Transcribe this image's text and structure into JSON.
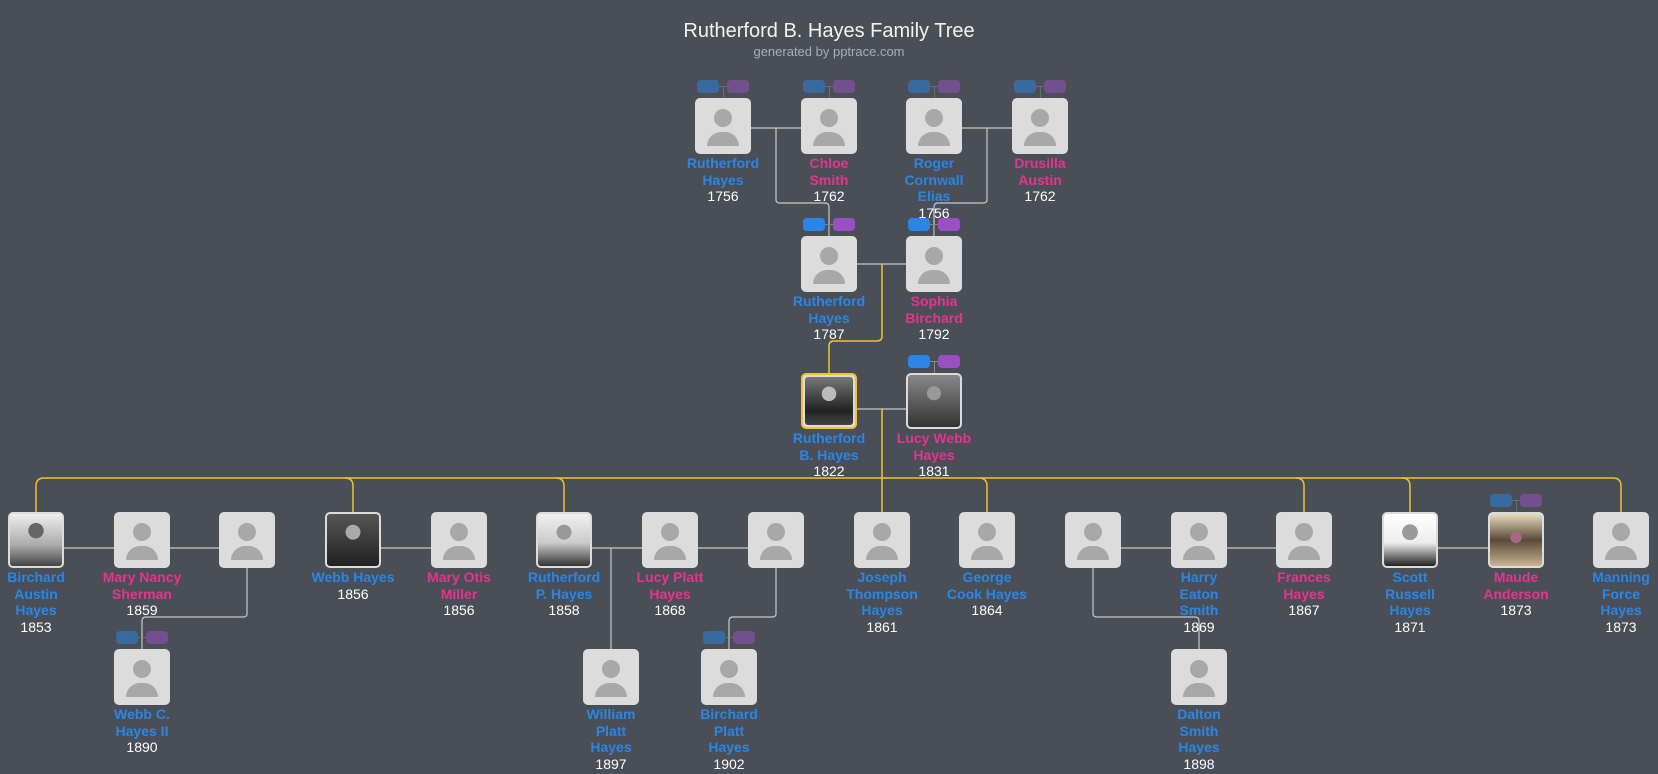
{
  "title": "Rutherford B. Hayes Family Tree",
  "subtitle": "generated by pptrace.com",
  "colors": {
    "male": "#2a86e6",
    "female": "#e6338f",
    "highlight": "#f2c230",
    "line": "#c8c8c8",
    "badge_blue": "#2a86e6",
    "badge_purple": "#9b4fc4"
  },
  "people": [
    {
      "id": "p1",
      "name": "Rutherford\nHayes",
      "year": "1756",
      "gender": "male",
      "photo": false
    },
    {
      "id": "p2",
      "name": "Chloe\nSmith",
      "year": "1762",
      "gender": "female",
      "photo": false
    },
    {
      "id": "p3",
      "name": "Roger\nCornwall\nElias",
      "year": "1756",
      "gender": "male",
      "photo": false
    },
    {
      "id": "p4",
      "name": "Drusilla\nAustin",
      "year": "1762",
      "gender": "female",
      "photo": false
    },
    {
      "id": "p5",
      "name": "Rutherford\nHayes",
      "year": "1787",
      "gender": "male",
      "photo": false
    },
    {
      "id": "p6",
      "name": "Sophia\nBirchard",
      "year": "1792",
      "gender": "female",
      "photo": false
    },
    {
      "id": "p7",
      "name": "Rutherford\nB. Hayes",
      "year": "1822",
      "gender": "male",
      "photo": true,
      "highlighted": true
    },
    {
      "id": "p8",
      "name": "Lucy Webb\nHayes",
      "year": "1831",
      "gender": "female",
      "photo": true
    },
    {
      "id": "p9",
      "name": "Birchard\nAustin\nHayes",
      "year": "1853",
      "gender": "male",
      "photo": true
    },
    {
      "id": "p10",
      "name": "Mary Nancy\nSherman",
      "year": "1859",
      "gender": "female",
      "photo": false
    },
    {
      "id": "p11",
      "name": "",
      "year": "",
      "gender": "male",
      "photo": false
    },
    {
      "id": "p12",
      "name": "Webb Hayes",
      "year": "1856",
      "gender": "male",
      "photo": true
    },
    {
      "id": "p13",
      "name": "Mary Otis\nMiller",
      "year": "1856",
      "gender": "female",
      "photo": false
    },
    {
      "id": "p14",
      "name": "Rutherford\nP. Hayes",
      "year": "1858",
      "gender": "male",
      "photo": true
    },
    {
      "id": "p15",
      "name": "Lucy Platt\nHayes",
      "year": "1868",
      "gender": "female",
      "photo": false
    },
    {
      "id": "p16",
      "name": "",
      "year": "",
      "gender": "male",
      "photo": false
    },
    {
      "id": "p17",
      "name": "Joseph\nThompson\nHayes",
      "year": "1861",
      "gender": "male",
      "photo": false
    },
    {
      "id": "p18",
      "name": "George\nCook Hayes",
      "year": "1864",
      "gender": "male",
      "photo": false
    },
    {
      "id": "p19",
      "name": "",
      "year": "",
      "gender": "male",
      "photo": false
    },
    {
      "id": "p20",
      "name": "Harry\nEaton\nSmith",
      "year": "1869",
      "gender": "male",
      "photo": false
    },
    {
      "id": "p21",
      "name": "Frances\nHayes",
      "year": "1867",
      "gender": "female",
      "photo": false
    },
    {
      "id": "p22",
      "name": "Scott\nRussell\nHayes",
      "year": "1871",
      "gender": "male",
      "photo": true
    },
    {
      "id": "p23",
      "name": "Maude\nAnderson",
      "year": "1873",
      "gender": "female",
      "photo": true
    },
    {
      "id": "p24",
      "name": "Manning\nForce\nHayes",
      "year": "1873",
      "gender": "male",
      "photo": false
    },
    {
      "id": "p25",
      "name": "Webb C.\nHayes II",
      "year": "1890",
      "gender": "male",
      "photo": false
    },
    {
      "id": "p26",
      "name": "William\nPlatt\nHayes",
      "year": "1897",
      "gender": "male",
      "photo": false
    },
    {
      "id": "p27",
      "name": "Birchard\nPlatt\nHayes",
      "year": "1902",
      "gender": "male",
      "photo": false
    },
    {
      "id": "p28",
      "name": "Dalton\nSmith\nHayes",
      "year": "1898",
      "gender": "male",
      "photo": false
    }
  ]
}
